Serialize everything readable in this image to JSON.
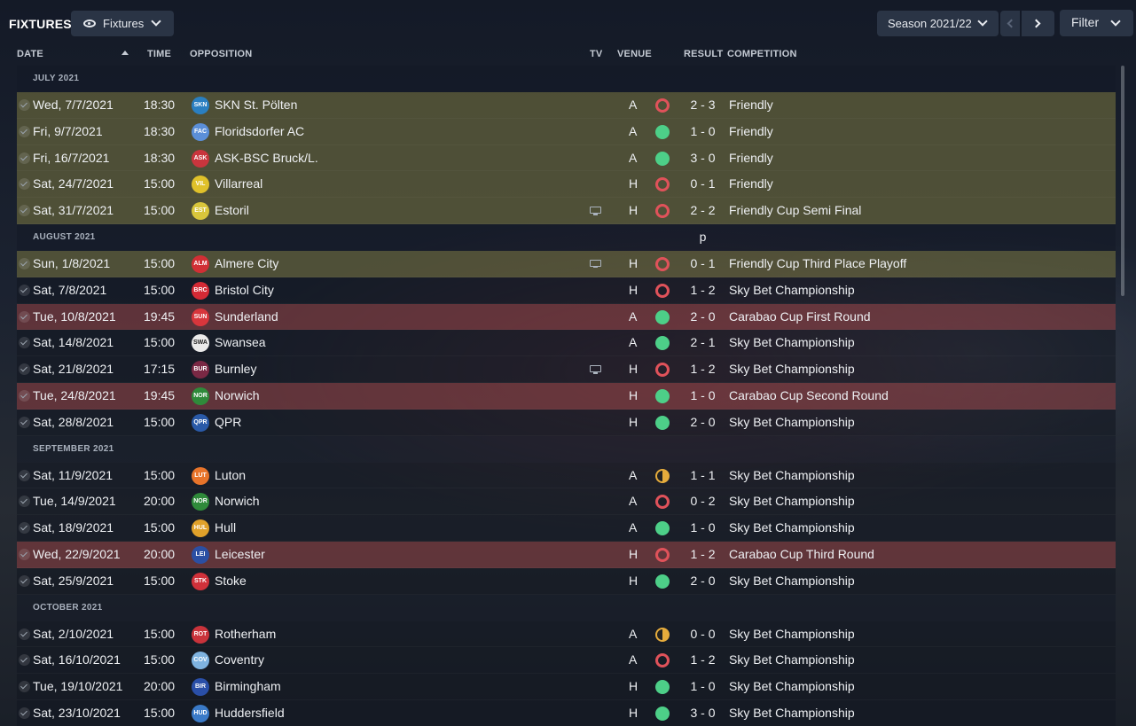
{
  "header": {
    "title": "FIXTURES",
    "view_label": "Fixtures",
    "season_label": "Season 2021/22",
    "filter_label": "Filter"
  },
  "columns": {
    "date": "DATE",
    "time": "TIME",
    "opposition": "OPPOSITION",
    "tv": "TV",
    "venue": "VENUE",
    "result": "RESULT",
    "competition": "COMPETITION"
  },
  "months": [
    {
      "label": "JULY 2021",
      "fixtures": [
        {
          "date": "Wed, 7/7/2021",
          "time": "18:30",
          "opposition": "SKN St. Pölten",
          "badge": "SKN",
          "badge_color": "#2a7fc1",
          "tv": false,
          "venue": "A",
          "result": "L",
          "score": "2 - 3",
          "competition": "Friendly",
          "type": "friendly"
        },
        {
          "date": "Fri, 9/7/2021",
          "time": "18:30",
          "opposition": "Floridsdorfer AC",
          "badge": "FAC",
          "badge_color": "#5b8fd8",
          "tv": false,
          "venue": "A",
          "result": "W",
          "score": "1 - 0",
          "competition": "Friendly",
          "type": "friendly"
        },
        {
          "date": "Fri, 16/7/2021",
          "time": "18:30",
          "opposition": "ASK-BSC Bruck/L.",
          "badge": "ASK",
          "badge_color": "#c9353d",
          "tv": false,
          "venue": "A",
          "result": "W",
          "score": "3 - 0",
          "competition": "Friendly",
          "type": "friendly"
        },
        {
          "date": "Sat, 24/7/2021",
          "time": "15:00",
          "opposition": "Villarreal",
          "badge": "VIL",
          "badge_color": "#e0c12a",
          "tv": false,
          "venue": "H",
          "result": "L",
          "score": "0 - 1",
          "competition": "Friendly",
          "type": "friendly"
        },
        {
          "date": "Sat, 31/7/2021",
          "time": "15:00",
          "opposition": "Estoril",
          "badge": "EST",
          "badge_color": "#d9c63b",
          "tv": true,
          "venue": "H",
          "result": "L",
          "score": "2 - 2 p",
          "competition": "Friendly Cup Semi Final",
          "type": "friendly"
        }
      ]
    },
    {
      "label": "AUGUST 2021",
      "fixtures": [
        {
          "date": "Sun, 1/8/2021",
          "time": "15:00",
          "opposition": "Almere City",
          "badge": "ALM",
          "badge_color": "#d12f35",
          "tv": true,
          "venue": "H",
          "result": "L",
          "score": "0 - 1",
          "competition": "Friendly Cup Third Place Playoff",
          "type": "friendly"
        },
        {
          "date": "Sat, 7/8/2021",
          "time": "15:00",
          "opposition": "Bristol City",
          "badge": "BRC",
          "badge_color": "#d42a35",
          "tv": false,
          "venue": "H",
          "result": "L",
          "score": "1 - 2",
          "competition": "Sky Bet Championship",
          "type": "league"
        },
        {
          "date": "Tue, 10/8/2021",
          "time": "19:45",
          "opposition": "Sunderland",
          "badge": "SUN",
          "badge_color": "#d8363c",
          "tv": false,
          "venue": "A",
          "result": "W",
          "score": "2 - 0",
          "competition": "Carabao Cup First Round",
          "type": "cup"
        },
        {
          "date": "Sat, 14/8/2021",
          "time": "15:00",
          "opposition": "Swansea",
          "badge": "SWA",
          "badge_color": "#eaeaea",
          "tv": false,
          "venue": "A",
          "result": "W",
          "score": "2 - 1",
          "competition": "Sky Bet Championship",
          "type": "league"
        },
        {
          "date": "Sat, 21/8/2021",
          "time": "17:15",
          "opposition": "Burnley",
          "badge": "BUR",
          "badge_color": "#7a2844",
          "tv": true,
          "venue": "H",
          "result": "L",
          "score": "1 - 2",
          "competition": "Sky Bet Championship",
          "type": "league"
        },
        {
          "date": "Tue, 24/8/2021",
          "time": "19:45",
          "opposition": "Norwich",
          "badge": "NOR",
          "badge_color": "#2f8a3a",
          "tv": false,
          "venue": "H",
          "result": "W",
          "score": "1 - 0",
          "competition": "Carabao Cup Second Round",
          "type": "cup"
        },
        {
          "date": "Sat, 28/8/2021",
          "time": "15:00",
          "opposition": "QPR",
          "badge": "QPR",
          "badge_color": "#2a5aa8",
          "tv": false,
          "venue": "H",
          "result": "W",
          "score": "2 - 0",
          "competition": "Sky Bet Championship",
          "type": "league"
        }
      ]
    },
    {
      "label": "SEPTEMBER 2021",
      "fixtures": [
        {
          "date": "Sat, 11/9/2021",
          "time": "15:00",
          "opposition": "Luton",
          "badge": "LUT",
          "badge_color": "#e8742a",
          "tv": false,
          "venue": "A",
          "result": "D",
          "score": "1 - 1",
          "competition": "Sky Bet Championship",
          "type": "league"
        },
        {
          "date": "Tue, 14/9/2021",
          "time": "20:00",
          "opposition": "Norwich",
          "badge": "NOR",
          "badge_color": "#2f8a3a",
          "tv": false,
          "venue": "A",
          "result": "L",
          "score": "0 - 2",
          "competition": "Sky Bet Championship",
          "type": "league"
        },
        {
          "date": "Sat, 18/9/2021",
          "time": "15:00",
          "opposition": "Hull",
          "badge": "HUL",
          "badge_color": "#e0a12a",
          "tv": false,
          "venue": "A",
          "result": "W",
          "score": "1 - 0",
          "competition": "Sky Bet Championship",
          "type": "league"
        },
        {
          "date": "Wed, 22/9/2021",
          "time": "20:00",
          "opposition": "Leicester",
          "badge": "LEI",
          "badge_color": "#2b4fa3",
          "tv": false,
          "venue": "H",
          "result": "L",
          "score": "1 - 2",
          "competition": "Carabao Cup Third Round",
          "type": "cup"
        },
        {
          "date": "Sat, 25/9/2021",
          "time": "15:00",
          "opposition": "Stoke",
          "badge": "STK",
          "badge_color": "#d0313a",
          "tv": false,
          "venue": "H",
          "result": "W",
          "score": "2 - 0",
          "competition": "Sky Bet Championship",
          "type": "league"
        }
      ]
    },
    {
      "label": "OCTOBER 2021",
      "fixtures": [
        {
          "date": "Sat, 2/10/2021",
          "time": "15:00",
          "opposition": "Rotherham",
          "badge": "ROT",
          "badge_color": "#c9333b",
          "tv": false,
          "venue": "A",
          "result": "D",
          "score": "0 - 0",
          "competition": "Sky Bet Championship",
          "type": "league"
        },
        {
          "date": "Sat, 16/10/2021",
          "time": "15:00",
          "opposition": "Coventry",
          "badge": "COV",
          "badge_color": "#7fb3e0",
          "tv": false,
          "venue": "A",
          "result": "L",
          "score": "1 - 2",
          "competition": "Sky Bet Championship",
          "type": "league"
        },
        {
          "date": "Tue, 19/10/2021",
          "time": "20:00",
          "opposition": "Birmingham",
          "badge": "BIR",
          "badge_color": "#2a4fa8",
          "tv": false,
          "venue": "H",
          "result": "W",
          "score": "1 - 0",
          "competition": "Sky Bet Championship",
          "type": "league"
        },
        {
          "date": "Sat, 23/10/2021",
          "time": "15:00",
          "opposition": "Huddersfield",
          "badge": "HUD",
          "badge_color": "#3a7ac8",
          "tv": false,
          "venue": "H",
          "result": "W",
          "score": "3 - 0",
          "competition": "Sky Bet Championship",
          "type": "league"
        }
      ]
    }
  ]
}
